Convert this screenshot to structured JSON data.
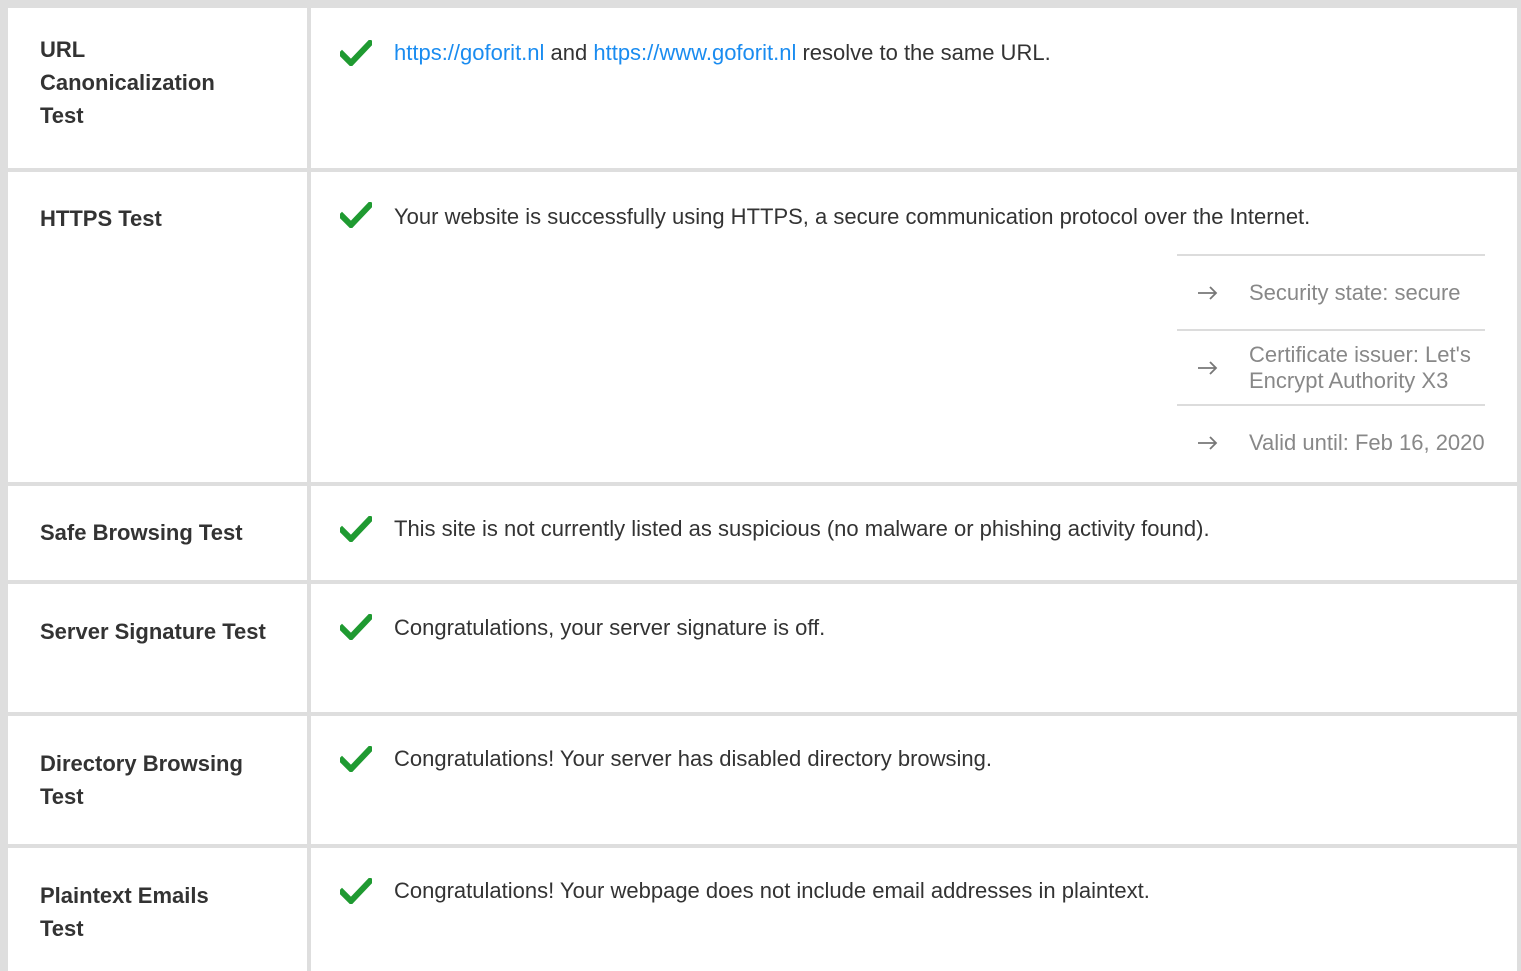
{
  "tests": [
    {
      "label": "URL Canonicalization Test",
      "link1": "https://goforit.nl",
      "between": " and ",
      "link2": "https://www.goforit.nl",
      "after": " resolve to the same URL."
    },
    {
      "label": "HTTPS Test",
      "message": "Your website is successfully using HTTPS, a secure communication protocol over the Internet.",
      "details": [
        "Security state: secure",
        "Certificate issuer: Let's Encrypt Authority X3",
        "Valid until: Feb 16, 2020"
      ]
    },
    {
      "label": "Safe Browsing Test",
      "message": "This site is not currently listed as suspicious (no malware or phishing activity found)."
    },
    {
      "label": "Server Signature Test",
      "message": "Congratulations, your server signature is off."
    },
    {
      "label": "Directory Browsing Test",
      "message": "Congratulations! Your server has disabled directory browsing."
    },
    {
      "label": "Plaintext Emails Test",
      "message": "Congratulations! Your webpage does not include email addresses in plaintext."
    }
  ],
  "icons": {
    "status": "check-icon",
    "detail": "arrow-right-icon"
  },
  "colors": {
    "pass": "#1f9a31",
    "link": "#1a8cf0",
    "detail_text": "#888888",
    "border": "#dedede"
  }
}
